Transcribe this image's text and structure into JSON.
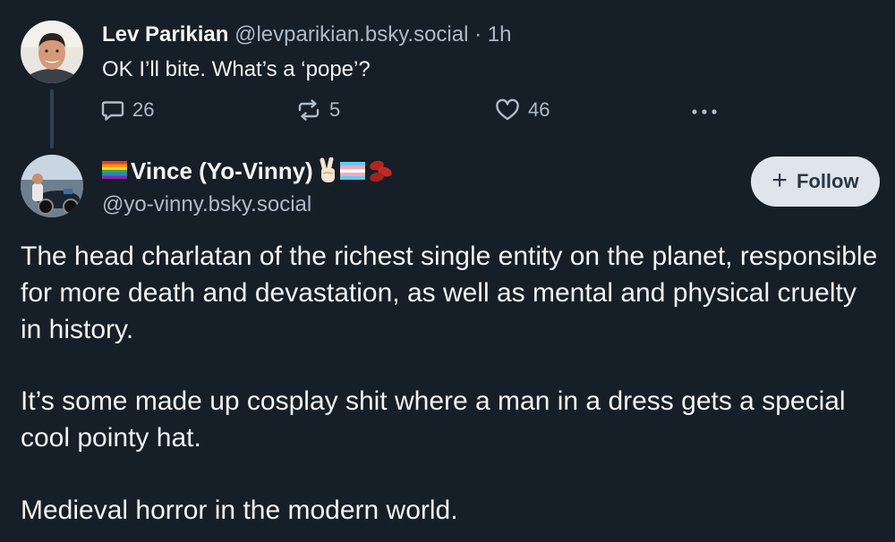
{
  "parent_post": {
    "author_name": "Lev Parikian",
    "handle": "@levparikian.bsky.social",
    "separator": "·",
    "timestamp": "1h",
    "text": "OK I’ll bite. What’s a ‘pope’?",
    "reply_count": "26",
    "repost_count": "5",
    "like_count": "46",
    "more_icon": "ellipsis-icon"
  },
  "main_post": {
    "author_name": "Vince (Yo-Vinny)",
    "name_prefix_emoji": "rainbow-flag",
    "name_suffix_emojis": [
      "victory-hand",
      "transgender-flag",
      "beans"
    ],
    "handle": "@yo-vinny.bsky.social",
    "follow_label": "Follow",
    "follow_icon": "plus",
    "paragraphs": [
      "The head charlatan of the richest single entity on the planet, responsible for more death and devastation, as well as mental and physical cruelty in history.",
      "It’s some made up cosplay shit where a man in a dress gets a special cool pointy hat.",
      "Medieval horror in the modern world."
    ]
  },
  "colors": {
    "background": "#161e27",
    "text_primary": "#f1f3f5",
    "text_secondary": "#aebbc9",
    "follow_button_bg": "#dfe5ec",
    "thread_line": "#2e4052"
  }
}
